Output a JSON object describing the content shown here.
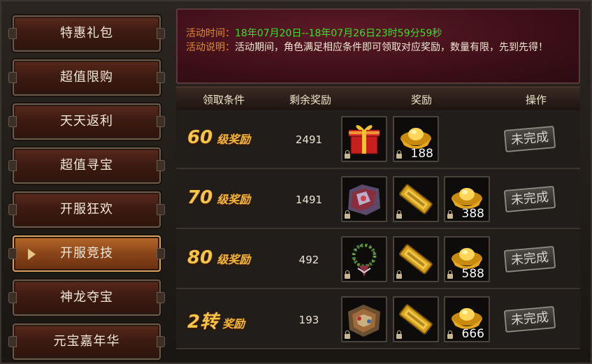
{
  "sidebar": {
    "items": [
      {
        "label": "特惠礼包",
        "active": false
      },
      {
        "label": "超值限购",
        "active": false
      },
      {
        "label": "天天返利",
        "active": false
      },
      {
        "label": "超值寻宝",
        "active": false
      },
      {
        "label": "开服狂欢",
        "active": false
      },
      {
        "label": "开服竞技",
        "active": true
      },
      {
        "label": "神龙夺宝",
        "active": false
      },
      {
        "label": "元宝嘉年华",
        "active": false
      }
    ]
  },
  "info": {
    "time_label": "活动时间：",
    "time_value": "18年07月20日--18年07月26日23时59分59秒",
    "desc_label": "活动说明：",
    "desc_value": "活动期间，角色满足相应条件即可领取对应奖励，数量有限，先到先得！"
  },
  "table": {
    "headers": {
      "condition": "领取条件",
      "remaining": "剩余奖励",
      "reward": "奖励",
      "action": "操作"
    },
    "rows": [
      {
        "level": "60",
        "suffix": "级奖励",
        "remaining": "2491",
        "rewards": [
          {
            "icon": "gift-box-icon",
            "qty": ""
          },
          {
            "icon": "gold-ingot-icon",
            "qty": "188"
          }
        ],
        "status": "未完成"
      },
      {
        "level": "70",
        "suffix": "级奖励",
        "remaining": "1491",
        "rewards": [
          {
            "icon": "armor-chest-icon",
            "qty": ""
          },
          {
            "icon": "gold-token-icon",
            "qty": ""
          },
          {
            "icon": "gold-ingot-icon",
            "qty": "388"
          }
        ],
        "status": "未完成"
      },
      {
        "level": "80",
        "suffix": "级奖励",
        "remaining": "492",
        "rewards": [
          {
            "icon": "bead-necklace-icon",
            "qty": ""
          },
          {
            "icon": "gold-token-icon",
            "qty": ""
          },
          {
            "icon": "gold-ingot-icon",
            "qty": "588"
          }
        ],
        "status": "未完成"
      },
      {
        "level": "2转",
        "suffix": "奖励",
        "remaining": "193",
        "rewards": [
          {
            "icon": "armor-pack-icon",
            "qty": ""
          },
          {
            "icon": "gold-token-icon",
            "qty": ""
          },
          {
            "icon": "gold-ingot-icon",
            "qty": "666"
          }
        ],
        "status": "未完成"
      }
    ]
  },
  "colors": {
    "label_orange": "#e08a2c",
    "time_green": "#3fdc2c",
    "level_gold": "#f7c548"
  }
}
